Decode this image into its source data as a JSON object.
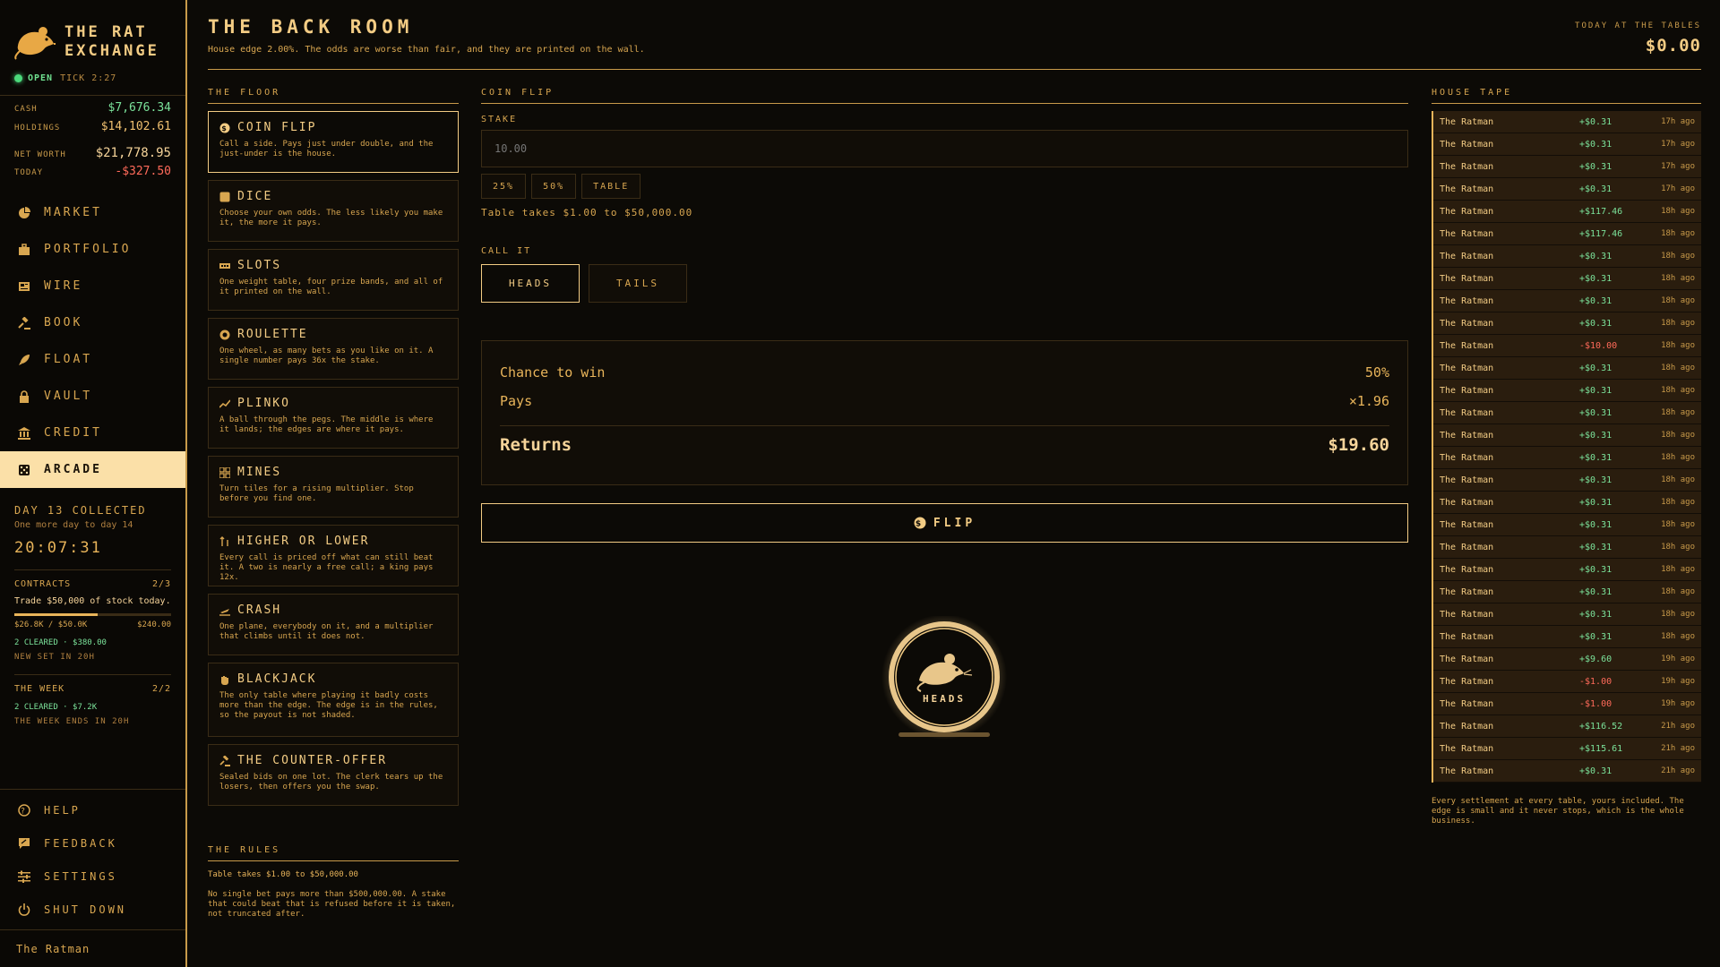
{
  "brand": {
    "line1": "THE RAT",
    "line2": "EXCHANGE"
  },
  "status": {
    "state": "OPEN",
    "tick": "TICK 2:27"
  },
  "money": {
    "cash_label": "CASH",
    "cash": "$7,676.34",
    "holdings_label": "HOLDINGS",
    "holdings": "$14,102.61",
    "networth_label": "NET WORTH",
    "networth": "$21,778.95",
    "today_label": "TODAY",
    "today": "-$327.50"
  },
  "nav": [
    {
      "label": "MARKET",
      "icon": "pie-chart-icon"
    },
    {
      "label": "PORTFOLIO",
      "icon": "briefcase-icon"
    },
    {
      "label": "WIRE",
      "icon": "newspaper-icon"
    },
    {
      "label": "BOOK",
      "icon": "gavel-icon"
    },
    {
      "label": "FLOAT",
      "icon": "rocket-icon"
    },
    {
      "label": "VAULT",
      "icon": "lock-icon"
    },
    {
      "label": "CREDIT",
      "icon": "bank-icon"
    },
    {
      "label": "ARCADE",
      "icon": "dice-icon"
    }
  ],
  "daily": {
    "title": "DAY 13 COLLECTED",
    "sub": "One more day to day 14",
    "timer": "20:07:31"
  },
  "contracts": {
    "label": "CONTRACTS",
    "count": "2/3",
    "task": "Trade $50,000 of stock today.",
    "progress": 0.53,
    "progress_text": "$26.8K / $50.0K",
    "reward": "$240.00",
    "cleared": "2 CLEARED · $380.00",
    "note": "NEW SET IN 20H"
  },
  "week": {
    "label": "THE WEEK",
    "count": "2/2",
    "cleared": "2 CLEARED · $7.2K",
    "note": "THE WEEK ENDS IN 20H"
  },
  "bottom_nav": [
    {
      "label": "HELP",
      "icon": "help-icon"
    },
    {
      "label": "FEEDBACK",
      "icon": "feedback-icon"
    },
    {
      "label": "SETTINGS",
      "icon": "sliders-icon"
    },
    {
      "label": "SHUT DOWN",
      "icon": "power-icon"
    }
  ],
  "user": "The Ratman",
  "header": {
    "title": "THE BACK ROOM",
    "sub": "House edge 2.00%. The odds are worse than fair, and they are printed on the wall.",
    "today_label": "TODAY AT THE TABLES",
    "today_value": "$0.00"
  },
  "floor": {
    "label": "THE FLOOR",
    "games": [
      {
        "name": "COIN FLIP",
        "icon": "coin-icon",
        "desc": "Call a side. Pays just under double, and the just-under is the house."
      },
      {
        "name": "DICE",
        "icon": "dice-icon",
        "desc": "Choose your own odds. The less likely you make it, the more it pays."
      },
      {
        "name": "SLOTS",
        "icon": "slots-icon",
        "desc": "One weight table, four prize bands, and all of it printed on the wall."
      },
      {
        "name": "ROULETTE",
        "icon": "roulette-icon",
        "desc": "One wheel, as many bets as you like on it. A single number pays 36x the stake."
      },
      {
        "name": "PLINKO",
        "icon": "trend-icon",
        "desc": "A ball through the pegs. The middle is where it lands; the edges are where it pays."
      },
      {
        "name": "MINES",
        "icon": "grid-icon",
        "desc": "Turn tiles for a rising multiplier. Stop before you find one."
      },
      {
        "name": "HIGHER OR LOWER",
        "icon": "arrows-icon",
        "desc": "Every call is priced off what can still beat it. A two is nearly a free call; a king pays 12x."
      },
      {
        "name": "CRASH",
        "icon": "plane-icon",
        "desc": "One plane, everybody on it, and a multiplier that climbs until it does not."
      },
      {
        "name": "BLACKJACK",
        "icon": "hand-icon",
        "desc": "The only table where playing it badly costs more than the edge. The edge is in the rules, so the payout is not shaded."
      },
      {
        "name": "THE COUNTER-OFFER",
        "icon": "gavel-icon",
        "desc": "Sealed bids on one lot. The clerk tears up the losers, then offers you the swap."
      }
    ]
  },
  "rules": {
    "label": "THE RULES",
    "line": "Table takes $1.00 to $50,000.00",
    "text": "No single bet pays more than $500,000.00. A stake that could beat that is refused before it is taken, not truncated after."
  },
  "flip": {
    "label": "COIN FLIP",
    "stake_label": "STAKE",
    "stake_placeholder": "10.00",
    "quick": [
      "25%",
      "50%",
      "TABLE"
    ],
    "range": "Table takes $1.00 to $50,000.00",
    "call_label": "CALL IT",
    "calls": [
      "HEADS",
      "TAILS"
    ],
    "chance_label": "Chance to win",
    "chance": "50%",
    "pays_label": "Pays",
    "pays": "×1.96",
    "returns_label": "Returns",
    "returns": "$19.60",
    "button": "FLIP",
    "coin_face": "HEADS"
  },
  "tape": {
    "label": "HOUSE TAPE",
    "rows": [
      {
        "user": "The Ratman",
        "amount": "+$0.31",
        "time": "17h ago",
        "neg": false
      },
      {
        "user": "The Ratman",
        "amount": "+$0.31",
        "time": "17h ago",
        "neg": false
      },
      {
        "user": "The Ratman",
        "amount": "+$0.31",
        "time": "17h ago",
        "neg": false
      },
      {
        "user": "The Ratman",
        "amount": "+$0.31",
        "time": "17h ago",
        "neg": false
      },
      {
        "user": "The Ratman",
        "amount": "+$117.46",
        "time": "18h ago",
        "neg": false
      },
      {
        "user": "The Ratman",
        "amount": "+$117.46",
        "time": "18h ago",
        "neg": false
      },
      {
        "user": "The Ratman",
        "amount": "+$0.31",
        "time": "18h ago",
        "neg": false
      },
      {
        "user": "The Ratman",
        "amount": "+$0.31",
        "time": "18h ago",
        "neg": false
      },
      {
        "user": "The Ratman",
        "amount": "+$0.31",
        "time": "18h ago",
        "neg": false
      },
      {
        "user": "The Ratman",
        "amount": "+$0.31",
        "time": "18h ago",
        "neg": false
      },
      {
        "user": "The Ratman",
        "amount": "-$10.00",
        "time": "18h ago",
        "neg": true
      },
      {
        "user": "The Ratman",
        "amount": "+$0.31",
        "time": "18h ago",
        "neg": false
      },
      {
        "user": "The Ratman",
        "amount": "+$0.31",
        "time": "18h ago",
        "neg": false
      },
      {
        "user": "The Ratman",
        "amount": "+$0.31",
        "time": "18h ago",
        "neg": false
      },
      {
        "user": "The Ratman",
        "amount": "+$0.31",
        "time": "18h ago",
        "neg": false
      },
      {
        "user": "The Ratman",
        "amount": "+$0.31",
        "time": "18h ago",
        "neg": false
      },
      {
        "user": "The Ratman",
        "amount": "+$0.31",
        "time": "18h ago",
        "neg": false
      },
      {
        "user": "The Ratman",
        "amount": "+$0.31",
        "time": "18h ago",
        "neg": false
      },
      {
        "user": "The Ratman",
        "amount": "+$0.31",
        "time": "18h ago",
        "neg": false
      },
      {
        "user": "The Ratman",
        "amount": "+$0.31",
        "time": "18h ago",
        "neg": false
      },
      {
        "user": "The Ratman",
        "amount": "+$0.31",
        "time": "18h ago",
        "neg": false
      },
      {
        "user": "The Ratman",
        "amount": "+$0.31",
        "time": "18h ago",
        "neg": false
      },
      {
        "user": "The Ratman",
        "amount": "+$0.31",
        "time": "18h ago",
        "neg": false
      },
      {
        "user": "The Ratman",
        "amount": "+$0.31",
        "time": "18h ago",
        "neg": false
      },
      {
        "user": "The Ratman",
        "amount": "+$9.60",
        "time": "19h ago",
        "neg": false
      },
      {
        "user": "The Ratman",
        "amount": "-$1.00",
        "time": "19h ago",
        "neg": true
      },
      {
        "user": "The Ratman",
        "amount": "-$1.00",
        "time": "19h ago",
        "neg": true
      },
      {
        "user": "The Ratman",
        "amount": "+$116.52",
        "time": "21h ago",
        "neg": false
      },
      {
        "user": "The Ratman",
        "amount": "+$115.61",
        "time": "21h ago",
        "neg": false
      },
      {
        "user": "The Ratman",
        "amount": "+$0.31",
        "time": "21h ago",
        "neg": false
      }
    ],
    "note": "Every settlement at every table, yours included. The edge is small and it never stops, which is the whole business."
  },
  "colors": {
    "accent": "#e8b45a",
    "highlight": "#fbe0a8",
    "positive": "#7be29a",
    "negative": "#ff6a5a",
    "background": "#0c0a06"
  }
}
